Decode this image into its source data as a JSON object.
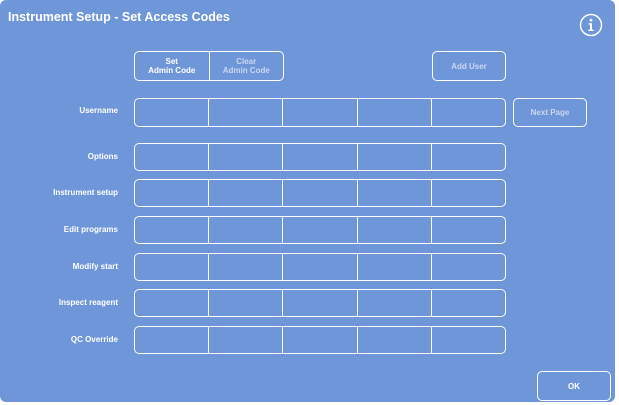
{
  "header": {
    "title": "Instrument Setup - Set Access Codes",
    "info_icon": "info-circle-icon"
  },
  "toolbar": {
    "set_admin_code": [
      "Set",
      "Admin Code"
    ],
    "clear_admin_code": [
      "Clear",
      "Admin Code"
    ],
    "add_user_label": "Add User",
    "next_page_label": "Next Page"
  },
  "rows": [
    {
      "label": "Username",
      "cells": [
        "",
        "",
        "",
        "",
        ""
      ]
    },
    {
      "label": "Options",
      "cells": [
        "",
        "",
        "",
        "",
        ""
      ]
    },
    {
      "label": "Instrument setup",
      "cells": [
        "",
        "",
        "",
        "",
        ""
      ]
    },
    {
      "label": "Edit programs",
      "cells": [
        "",
        "",
        "",
        "",
        ""
      ]
    },
    {
      "label": "Modify start",
      "cells": [
        "",
        "",
        "",
        "",
        ""
      ]
    },
    {
      "label": "Inspect reagent",
      "cells": [
        "",
        "",
        "",
        "",
        ""
      ]
    },
    {
      "label": "QC Override",
      "cells": [
        "",
        "",
        "",
        "",
        ""
      ]
    }
  ],
  "footer": {
    "ok_label": "OK"
  },
  "colors": {
    "background": "#6f96d8",
    "foreground": "#ffffff",
    "disabled_text": "#c9d7f0"
  }
}
